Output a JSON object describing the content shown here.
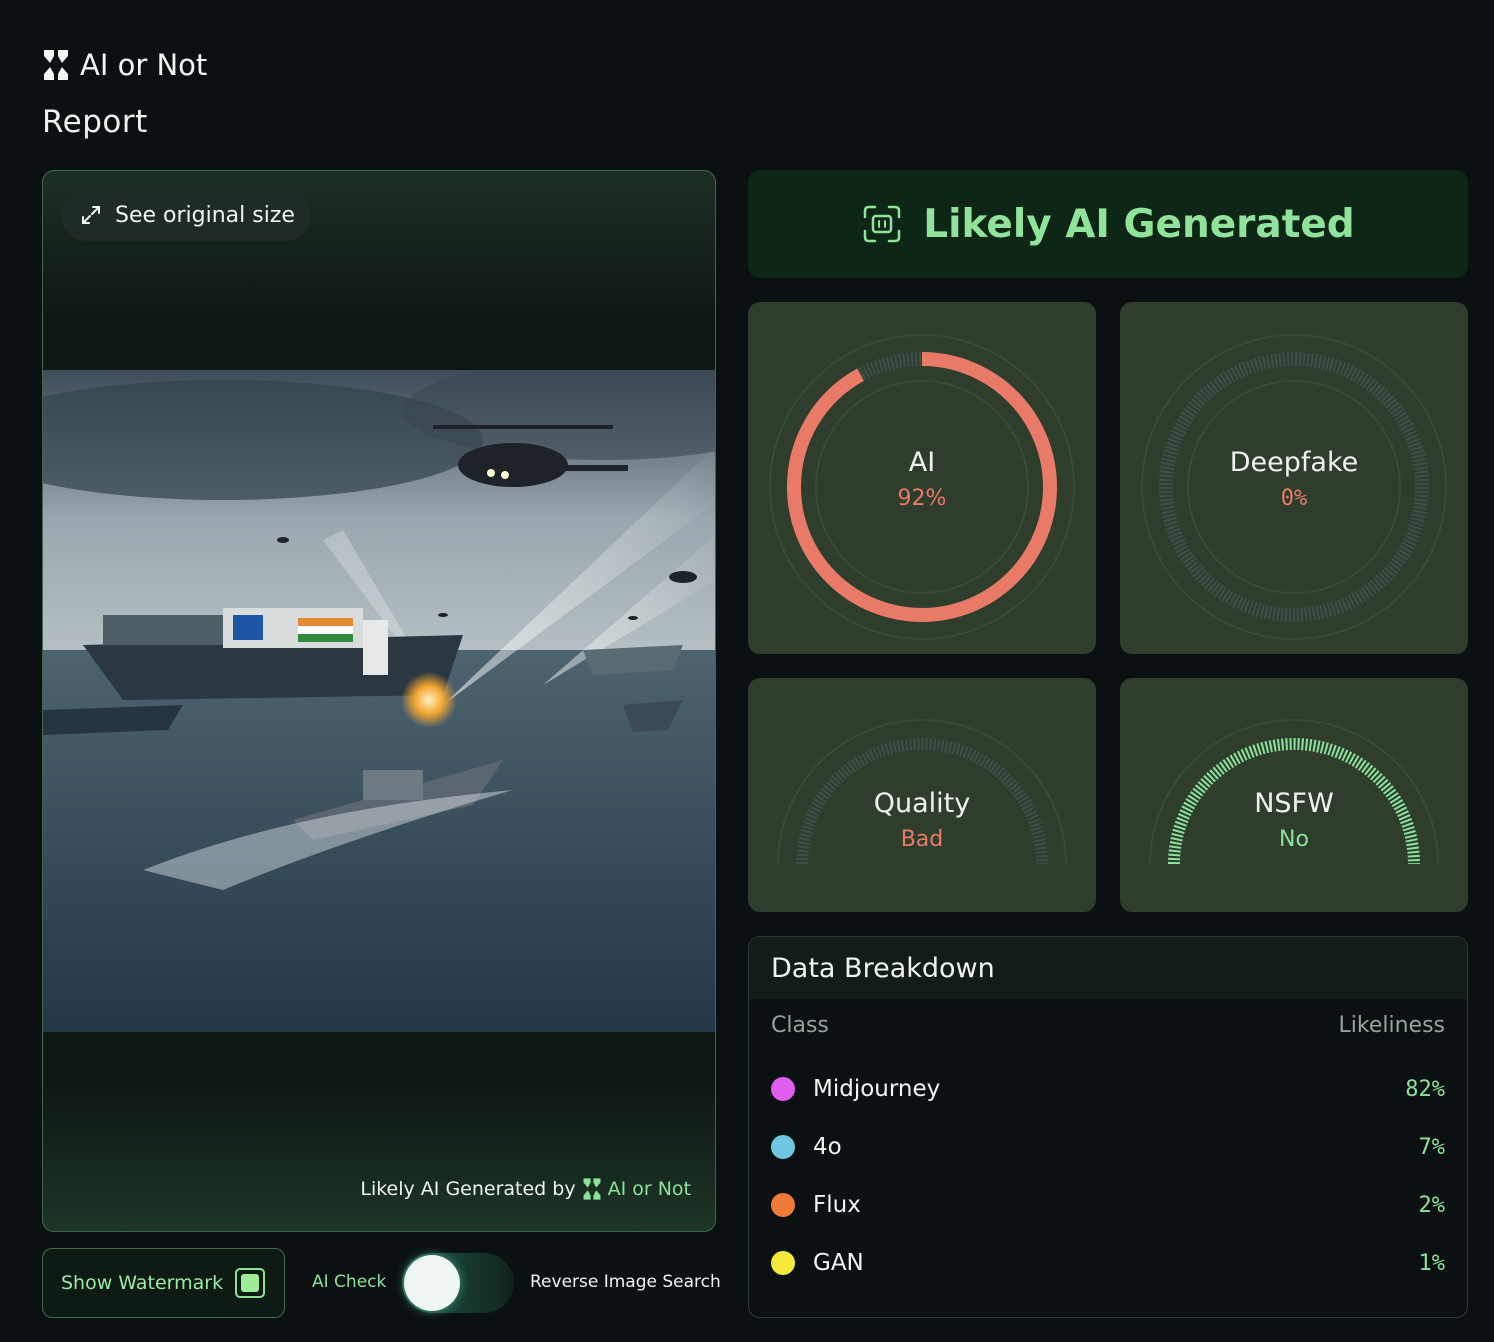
{
  "header": {
    "brand_name": "AI or Not",
    "page_title": "Report"
  },
  "image_panel": {
    "see_original_label": "See original size",
    "watermark_prefix": "Likely AI Generated by",
    "watermark_brand": "AI or Not"
  },
  "controls": {
    "show_watermark_label": "Show Watermark",
    "show_watermark_checked": true,
    "ai_check_label": "AI Check",
    "toggle_on": false,
    "reverse_search_label": "Reverse Image Search"
  },
  "verdict": {
    "label": "Likely AI Generated"
  },
  "gauges": {
    "ai": {
      "label": "AI",
      "value": "92%",
      "fraction": 0.92,
      "color": "#e97a68"
    },
    "deepfake": {
      "label": "Deepfake",
      "value": "0%",
      "fraction": 0.0,
      "color": "#e97a68"
    },
    "quality": {
      "label": "Quality",
      "value": "Bad",
      "fraction": 0.0,
      "color": "#e97a68"
    },
    "nsfw": {
      "label": "NSFW",
      "value": "No",
      "fraction": 1.0,
      "color": "#8be39a"
    }
  },
  "breakdown": {
    "title": "Data Breakdown",
    "col_class": "Class",
    "col_likeliness": "Likeliness",
    "rows": [
      {
        "name": "Midjourney",
        "pct": "82%",
        "color": "#e05ff0"
      },
      {
        "name": "4o",
        "pct": "7%",
        "color": "#6ec6e0"
      },
      {
        "name": "Flux",
        "pct": "2%",
        "color": "#f07a38"
      },
      {
        "name": "GAN",
        "pct": "1%",
        "color": "#f5ea3c"
      }
    ]
  },
  "colors": {
    "accent_green": "#8be39a",
    "danger_red": "#e97a68",
    "card_bg": "#2f3d2c",
    "page_bg": "#0b1013"
  }
}
